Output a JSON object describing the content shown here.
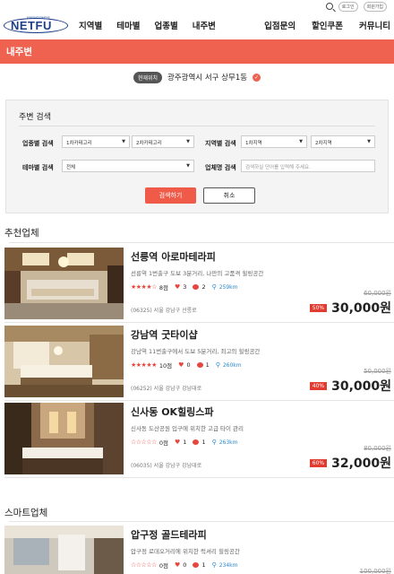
{
  "util": {
    "login": "로그인",
    "join": "회원가입"
  },
  "logo": {
    "text": "NETFU",
    "tagline": "premium healing"
  },
  "nav": [
    "지역별",
    "테마별",
    "업종별",
    "내주변"
  ],
  "nav_right": [
    "입점문의",
    "할인쿠폰",
    "커뮤니티"
  ],
  "page_title": "내주변",
  "location": {
    "badge": "현재위치",
    "text": "광주광역시 서구 상무1동",
    "button": "✓"
  },
  "search": {
    "title": "주변 검색",
    "industry_label": "업종별 검색",
    "industry_cat1": "1차카테고리",
    "industry_cat2": "2차카테고리",
    "region_label": "지역별 검색",
    "region_1": "1차지역",
    "region_2": "2차지역",
    "theme_label": "테마별 검색",
    "theme_value": "전체",
    "name_label": "업체명 검색",
    "name_placeholder": "검색하실 단어를 입력해 주세요.",
    "submit": "검색하기",
    "cancel": "취소"
  },
  "recommended": {
    "title": "추천업체",
    "items": [
      {
        "name": "선릉역 아로마테라피",
        "desc": "선릉역 1번출구 도보 3분거리, 나만의 고품격 힐링공간",
        "rating": 4,
        "score": "8점",
        "likes": "3",
        "comments": "2",
        "distance": "259km",
        "address": "(06325) 서울 강남구 선릉로",
        "old_price": "60,000원",
        "discount": "50%",
        "price": "30,000원"
      },
      {
        "name": "강남역 굿타이샵",
        "desc": "강남역 11번출구에서 도보 5분거리, 최고의 힐링공간",
        "rating": 5,
        "score": "10점",
        "likes": "0",
        "comments": "1",
        "distance": "260km",
        "address": "(06252) 서울 강남구 강남대로",
        "old_price": "50,000원",
        "discount": "40%",
        "price": "30,000원"
      },
      {
        "name": "신사동 OK힐링스파",
        "desc": "신사동 도산공원 입구에 위치한 고급 타이 관리",
        "rating": 0,
        "score": "0점",
        "likes": "1",
        "comments": "1",
        "distance": "263km",
        "address": "(06035) 서울 강남구 강남대로",
        "old_price": "80,000원",
        "discount": "60%",
        "price": "32,000원"
      }
    ]
  },
  "smart": {
    "title": "스마트업체",
    "items": [
      {
        "name": "압구정 골드테라피",
        "desc": "압구정 로데오거리에 위치한 럭셔리 힐링공간",
        "rating": 0,
        "score": "0점",
        "likes": "0",
        "comments": "1",
        "distance": "234km",
        "old_price": "100,000원"
      }
    ]
  }
}
